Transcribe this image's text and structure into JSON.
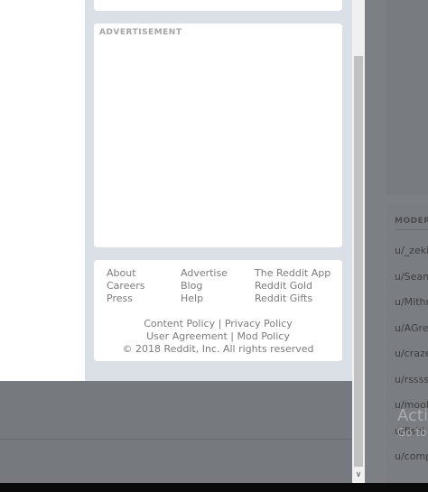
{
  "ad": {
    "label": "ADVERTISEMENT"
  },
  "footer": {
    "links": [
      [
        "About",
        "Advertise",
        "The Reddit App"
      ],
      [
        "Careers",
        "Blog",
        "Reddit Gold"
      ],
      [
        "Press",
        "Help",
        "Reddit Gifts"
      ]
    ],
    "content_policy": "Content Policy",
    "privacy_policy": "Privacy Policy",
    "user_agreement": "User Agreement",
    "mod_policy": "Mod Policy",
    "separator": "|",
    "copyright": "© 2018 Reddit, Inc. All rights reserved"
  },
  "sidebar": {
    "moderators_header": "MODERA",
    "moderators": [
      "u/_zeki",
      "u/Sean_",
      "u/Mithr",
      "u/AGre",
      "u/craze",
      "u/rssss",
      "u/mooli",
      "u/fishi",
      "u/comp"
    ]
  },
  "watermark": {
    "line1": "Activ",
    "line2": "Go to"
  },
  "scrollbar": {
    "down_arrow": "∨"
  },
  "colors": {
    "overlay": "#7b7d80",
    "card": "#ffffff",
    "column_bg": "#dae0e6",
    "footer_text": "#7c7c7c"
  }
}
